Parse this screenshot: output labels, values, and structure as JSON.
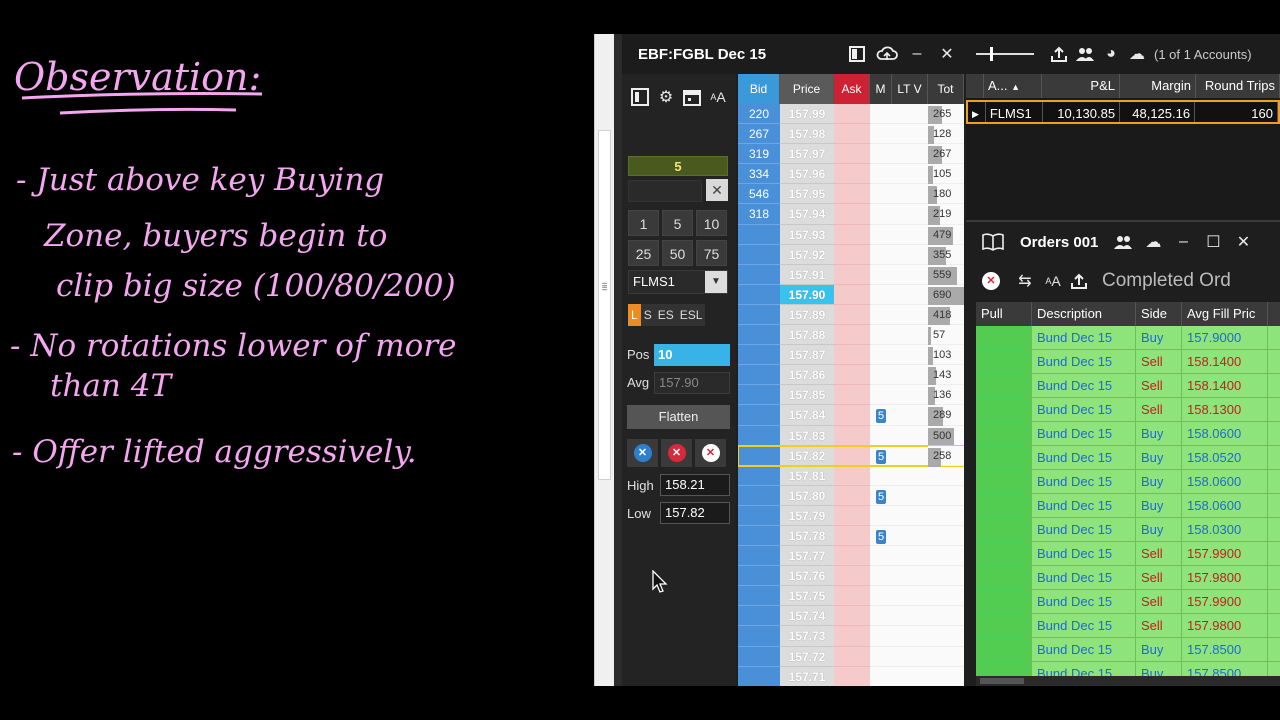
{
  "notes": {
    "heading": "Observation:",
    "lines": [
      "- Just above key Buying",
      "Zone, buyers begin to",
      "clip big size (100/80/200)",
      "- No rotations lower of more",
      "than 4T",
      "- Offer lifted aggressively."
    ]
  },
  "dom": {
    "title": "EBF:FGBL Dec 15",
    "quantity": "5",
    "qty_buttons": [
      "1",
      "5",
      "10",
      "25",
      "50",
      "75"
    ],
    "account": "FLMS1",
    "modes": [
      "L",
      "S",
      "ES",
      "ESL"
    ],
    "pos_label": "Pos",
    "pos_value": "10",
    "avg_label": "Avg",
    "avg_value": "157.90",
    "flatten_label": "Flatten",
    "high_label": "High",
    "high_value": "158.21",
    "low_label": "Low",
    "low_value": "157.82",
    "font_label": "A",
    "headers": {
      "bid": "Bid",
      "price": "Price",
      "ask": "Ask",
      "m": "M",
      "lt": "LT V",
      "tot": "Tot"
    },
    "last_price": "157.90",
    "current_price": "157.82",
    "ladder": [
      {
        "bid": "220",
        "price": "157.99",
        "m": "",
        "tot": "265",
        "tot_frac": 0.38
      },
      {
        "bid": "267",
        "price": "157.98",
        "m": "",
        "tot": "128",
        "tot_frac": 0.18
      },
      {
        "bid": "319",
        "price": "157.97",
        "m": "",
        "tot": "267",
        "tot_frac": 0.39
      },
      {
        "bid": "334",
        "price": "157.96",
        "m": "",
        "tot": "105",
        "tot_frac": 0.15
      },
      {
        "bid": "546",
        "price": "157.95",
        "m": "",
        "tot": "180",
        "tot_frac": 0.26
      },
      {
        "bid": "318",
        "price": "157.94",
        "m": "",
        "tot": "219",
        "tot_frac": 0.32
      },
      {
        "bid": "",
        "price": "157.93",
        "m": "",
        "tot": "479",
        "tot_frac": 0.69
      },
      {
        "bid": "",
        "price": "157.92",
        "m": "",
        "tot": "355",
        "tot_frac": 0.51
      },
      {
        "bid": "",
        "price": "157.91",
        "m": "",
        "tot": "559",
        "tot_frac": 0.81
      },
      {
        "bid": "",
        "price": "157.90",
        "m": "",
        "tot": "690",
        "tot_frac": 1.0
      },
      {
        "bid": "",
        "price": "157.89",
        "m": "",
        "tot": "418",
        "tot_frac": 0.6
      },
      {
        "bid": "",
        "price": "157.88",
        "m": "",
        "tot": "57",
        "tot_frac": 0.08
      },
      {
        "bid": "",
        "price": "157.87",
        "m": "",
        "tot": "103",
        "tot_frac": 0.15
      },
      {
        "bid": "",
        "price": "157.86",
        "m": "",
        "tot": "143",
        "tot_frac": 0.21
      },
      {
        "bid": "",
        "price": "157.85",
        "m": "",
        "tot": "136",
        "tot_frac": 0.2
      },
      {
        "bid": "",
        "price": "157.84",
        "m": "5",
        "tot": "289",
        "tot_frac": 0.42
      },
      {
        "bid": "",
        "price": "157.83",
        "m": "",
        "tot": "500",
        "tot_frac": 0.72
      },
      {
        "bid": "",
        "price": "157.82",
        "m": "5",
        "tot": "258",
        "tot_frac": 0.37
      },
      {
        "bid": "",
        "price": "157.81",
        "m": "",
        "tot": "",
        "tot_frac": 0
      },
      {
        "bid": "",
        "price": "157.80",
        "m": "5",
        "tot": "",
        "tot_frac": 0
      },
      {
        "bid": "",
        "price": "157.79",
        "m": "",
        "tot": "",
        "tot_frac": 0
      },
      {
        "bid": "",
        "price": "157.78",
        "m": "5",
        "tot": "",
        "tot_frac": 0
      },
      {
        "bid": "",
        "price": "157.77",
        "m": "",
        "tot": "",
        "tot_frac": 0
      },
      {
        "bid": "",
        "price": "157.76",
        "m": "",
        "tot": "",
        "tot_frac": 0
      },
      {
        "bid": "",
        "price": "157.75",
        "m": "",
        "tot": "",
        "tot_frac": 0
      },
      {
        "bid": "",
        "price": "157.74",
        "m": "",
        "tot": "",
        "tot_frac": 0
      },
      {
        "bid": "",
        "price": "157.73",
        "m": "",
        "tot": "",
        "tot_frac": 0
      },
      {
        "bid": "",
        "price": "157.72",
        "m": "",
        "tot": "",
        "tot_frac": 0
      },
      {
        "bid": "",
        "price": "157.71",
        "m": "",
        "tot": "",
        "tot_frac": 0
      }
    ]
  },
  "accounts": {
    "count_label": "(1 of 1 Accounts)",
    "headers": [
      "",
      "A...",
      "P&L",
      "Margin",
      "Round Trips"
    ],
    "rows": [
      [
        "",
        "FLMS1",
        "10,130.85",
        "48,125.16",
        "160"
      ]
    ]
  },
  "orders": {
    "title": "Orders 001",
    "filter_label": "Completed Ord",
    "font_label": "A",
    "headers": [
      "Pull",
      "Description",
      "Side",
      "Avg Fill Pric"
    ],
    "rows": [
      [
        "",
        "Bund Dec 15",
        "Buy",
        "157.9000"
      ],
      [
        "",
        "Bund Dec 15",
        "Sell",
        "158.1400"
      ],
      [
        "",
        "Bund Dec 15",
        "Sell",
        "158.1400"
      ],
      [
        "",
        "Bund Dec 15",
        "Sell",
        "158.1300"
      ],
      [
        "",
        "Bund Dec 15",
        "Buy",
        "158.0600"
      ],
      [
        "",
        "Bund Dec 15",
        "Buy",
        "158.0520"
      ],
      [
        "",
        "Bund Dec 15",
        "Buy",
        "158.0600"
      ],
      [
        "",
        "Bund Dec 15",
        "Buy",
        "158.0600"
      ],
      [
        "",
        "Bund Dec 15",
        "Buy",
        "158.0300"
      ],
      [
        "",
        "Bund Dec 15",
        "Sell",
        "157.9900"
      ],
      [
        "",
        "Bund Dec 15",
        "Sell",
        "157.9800"
      ],
      [
        "",
        "Bund Dec 15",
        "Sell",
        "157.9900"
      ],
      [
        "",
        "Bund Dec 15",
        "Sell",
        "157.9800"
      ],
      [
        "",
        "Bund Dec 15",
        "Buy",
        "157.8500"
      ],
      [
        "",
        "Bund Dec 15",
        "Buy",
        "157.8500"
      ]
    ]
  },
  "colors": {
    "buy": "#1e6ad6",
    "sell": "#c2221e",
    "notes_ink": "#f4a6f0",
    "orders_bg": "#8ee37a",
    "highlight": "#f2cf1f"
  },
  "icons": [
    "layout-icon",
    "gear-icon",
    "calendar-icon",
    "font-size-icon",
    "cloud-icon",
    "minimize-icon",
    "close-icon",
    "users-icon",
    "upload-icon",
    "book-icon",
    "maximize-icon",
    "swap-icon",
    "cancel-icon"
  ]
}
